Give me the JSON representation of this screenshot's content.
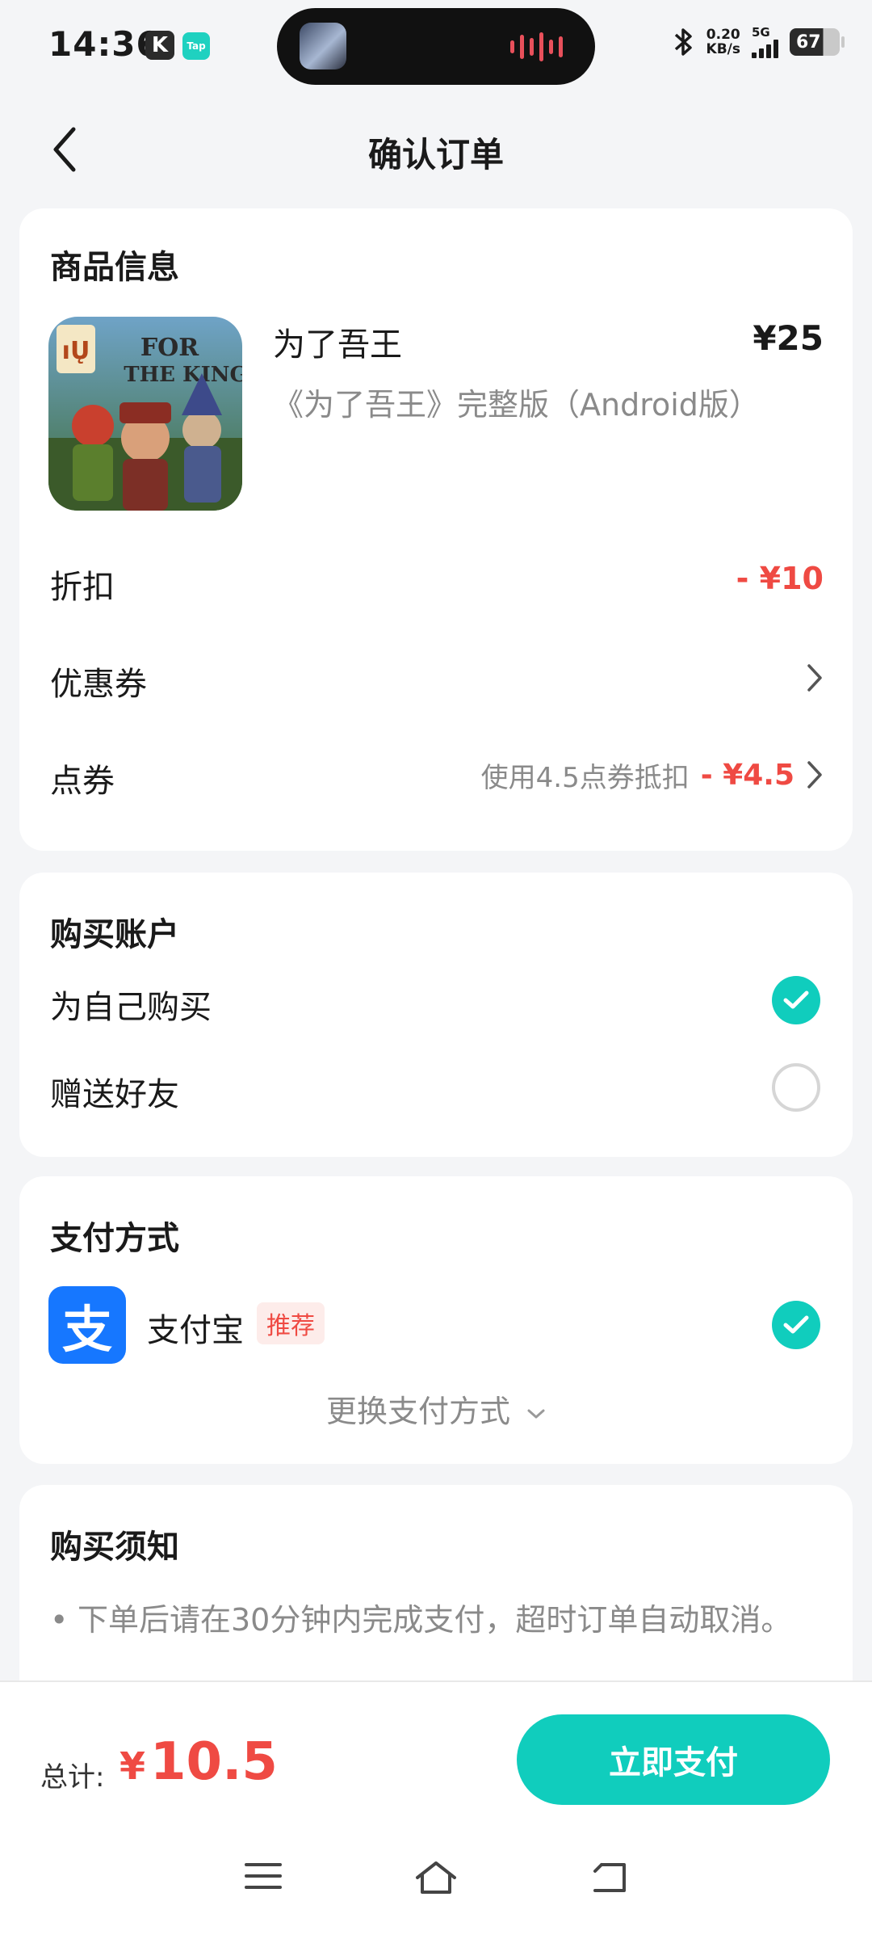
{
  "status_bar": {
    "time": "14:36",
    "k_badge": "K",
    "tap_badge": "Tap",
    "net_speed_value": "0.20",
    "net_speed_unit": "KB/s",
    "network": "5G",
    "battery": "67",
    "icons": [
      "bluetooth-icon",
      "signal-icon",
      "battery-icon"
    ]
  },
  "header": {
    "title": "确认订单",
    "back_icon": "chevron-left-icon"
  },
  "product_section": {
    "title": "商品信息",
    "name": "为了吾王",
    "price": "¥25",
    "description": "《为了吾王》完整版（Android版）",
    "discount_label": "折扣",
    "discount_value": "- ¥10",
    "coupon_label": "优惠券",
    "points_label": "点券",
    "points_note": "使用4.5点券抵扣",
    "points_value": "- ¥4.5"
  },
  "account_section": {
    "title": "购买账户",
    "options": [
      {
        "label": "为自己购买",
        "selected": true
      },
      {
        "label": "赠送好友",
        "selected": false
      }
    ]
  },
  "payment_section": {
    "title": "支付方式",
    "method_logo": "支",
    "method_name": "支付宝",
    "badge": "推荐",
    "change_label": "更换支付方式"
  },
  "notice_section": {
    "title": "购买须知",
    "text": "下单后请在30分钟内完成支付，超时订单自动取消。"
  },
  "bottom_bar": {
    "total_label": "总计:",
    "currency": "¥",
    "total_value": "10.5",
    "pay_button": "立即支付"
  },
  "colors": {
    "accent": "#10cdbd",
    "price_red": "#ef4a43",
    "alipay_blue": "#1677ff"
  }
}
